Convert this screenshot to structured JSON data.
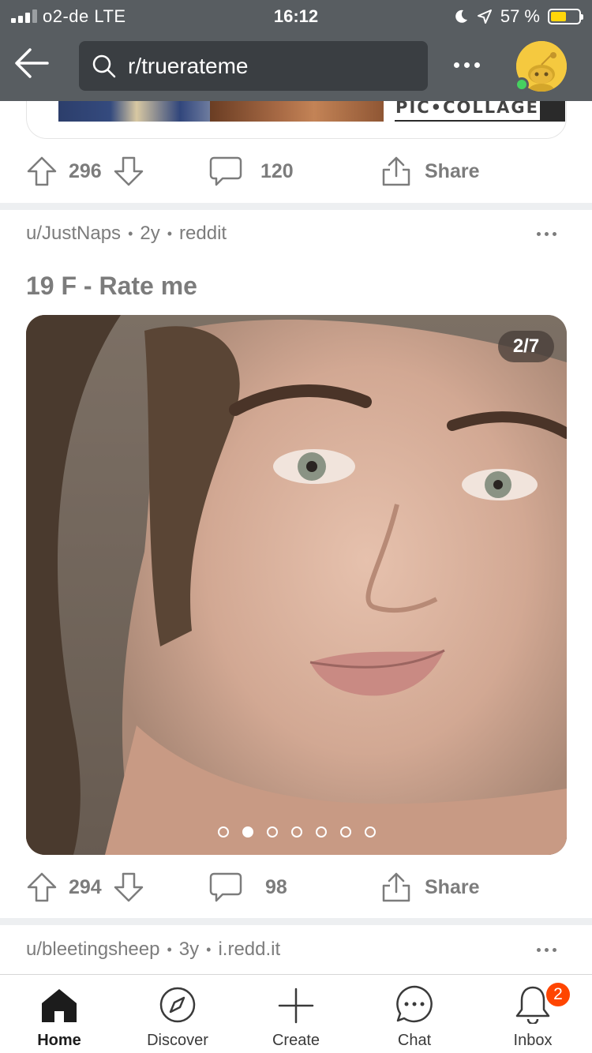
{
  "status_bar": {
    "carrier": "o2-de  LTE",
    "time": "16:12",
    "battery_percent": "57 %"
  },
  "header": {
    "search_text": "r/truerateme",
    "back_icon": "back-arrow-icon",
    "more_icon": "more-horizontal-icon",
    "avatar_icon": "snoo-avatar-icon"
  },
  "previous_post": {
    "thumbnail_overlay": "PIC•COLLAGE",
    "upvotes": "296",
    "comments": "120",
    "share_label": "Share"
  },
  "post": {
    "author": "u/JustNaps",
    "age": "2y",
    "source": "reddit",
    "title": "19 F - Rate me",
    "gallery_counter": "2/7",
    "gallery_total": 7,
    "gallery_index": 2,
    "upvotes": "294",
    "comments": "98",
    "share_label": "Share"
  },
  "next_post": {
    "author": "u/bleetingsheep",
    "age": "3y",
    "source": "i.redd.it"
  },
  "tabbar": {
    "home": "Home",
    "discover": "Discover",
    "create": "Create",
    "chat": "Chat",
    "inbox": "Inbox",
    "inbox_badge": "2"
  },
  "colors": {
    "header_bg": "#585d61",
    "accent": "#ff4500",
    "muted_text": "#7c7c7c",
    "online": "#46d160"
  }
}
